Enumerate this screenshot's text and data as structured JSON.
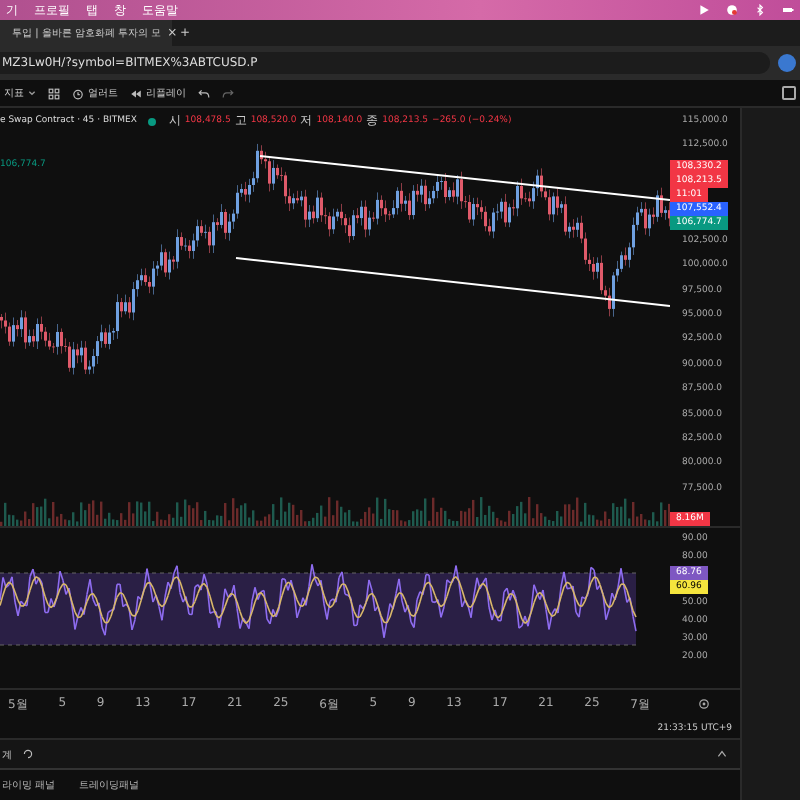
{
  "menu_bar": {
    "items": [
      "기",
      "프로필",
      "탭",
      "창",
      "도움말"
    ]
  },
  "browser_tab": {
    "title": "투입 | 올바른 암호화폐 투자의 모",
    "close": "×",
    "new_tab": "+"
  },
  "address_bar": {
    "url": "MZ3Lw0H/?symbol=BITMEX%3ABTCUSD.P"
  },
  "toolbar": {
    "items": [
      {
        "kind": "dropdown",
        "label": "지표"
      },
      {
        "kind": "grid"
      },
      {
        "kind": "alert",
        "label": "얼러트"
      },
      {
        "kind": "replay",
        "label": "리플레이"
      },
      {
        "kind": "undo"
      },
      {
        "kind": "redo"
      }
    ]
  },
  "legend": {
    "symbol": "e Swap Contract · 45 · BITMEX",
    "ohlc": [
      {
        "key": "시",
        "value": "108,478.5"
      },
      {
        "key": "고",
        "value": "108,520.0"
      },
      {
        "key": "저",
        "value": "108,140.0"
      },
      {
        "key": "종",
        "value": "108,213.5"
      }
    ],
    "change": "−265.0 (−0.24%)",
    "indicator_value": "106,774.7"
  },
  "price_axis": [
    {
      "kind": "tick",
      "text": "115,000.0"
    },
    {
      "kind": "tick",
      "text": "112,500.0"
    },
    {
      "kind": "tag",
      "text": "108,330.2",
      "color": "#f23645"
    },
    {
      "kind": "tag",
      "text": "108,213.5",
      "color": "#f23645"
    },
    {
      "kind": "tag",
      "text": "11:01",
      "color": "#f23645"
    },
    {
      "kind": "tag",
      "text": "107,552.4",
      "color": "#2962ff"
    },
    {
      "kind": "tag",
      "text": "106,774.7",
      "color": "#089981"
    },
    {
      "kind": "tick",
      "text": "102,500.0"
    },
    {
      "kind": "tick",
      "text": "100,000.0"
    },
    {
      "kind": "tick",
      "text": "97,500.0"
    },
    {
      "kind": "tick",
      "text": "95,000.0"
    },
    {
      "kind": "tick",
      "text": "92,500.0"
    },
    {
      "kind": "tick",
      "text": "90,000.0"
    },
    {
      "kind": "tick",
      "text": "87,500.0"
    },
    {
      "kind": "tick",
      "text": "85,000.0"
    },
    {
      "kind": "tick",
      "text": "82,500.0"
    },
    {
      "kind": "tick",
      "text": "80,000.0"
    },
    {
      "kind": "tick",
      "text": "77,500.0"
    }
  ],
  "volume_tag": "8.16M",
  "rsi_axis": [
    {
      "kind": "tick",
      "text": "90.00"
    },
    {
      "kind": "tick",
      "text": "80.00"
    },
    {
      "kind": "tag",
      "text": "68.76",
      "color": "#7e57c2"
    },
    {
      "kind": "tag",
      "text": "60.96",
      "color": "#f5e53d"
    },
    {
      "kind": "tick",
      "text": "50.00"
    },
    {
      "kind": "tick",
      "text": "40.00"
    },
    {
      "kind": "tick",
      "text": "30.00"
    },
    {
      "kind": "tick",
      "text": "20.00"
    }
  ],
  "time_axis": [
    "5월",
    "5",
    "9",
    "13",
    "17",
    "21",
    "25",
    "6월",
    "5",
    "9",
    "13",
    "17",
    "21",
    "25",
    "7월"
  ],
  "clock": "21:33:15 UTC+9",
  "bottom_bar": {
    "label": "계"
  },
  "panels": [
    "라이밍 패널",
    "트레이딩패널"
  ]
}
